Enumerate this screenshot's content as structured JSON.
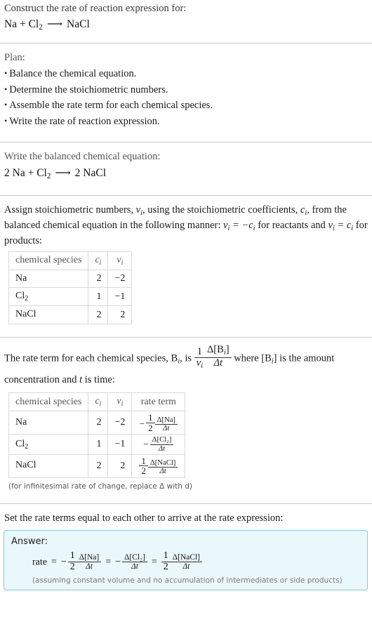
{
  "problem": {
    "prompt": "Construct the rate of reaction expression for:",
    "equation": {
      "reactant1": "Na",
      "plus": "+",
      "reactant2": "Cl",
      "reactant2_sub": "2",
      "arrow": "⟶",
      "product": "NaCl"
    }
  },
  "plan": {
    "label": "Plan:",
    "steps": [
      "Balance the chemical equation.",
      "Determine the stoichiometric numbers.",
      "Assemble the rate term for each chemical species.",
      "Write the rate of reaction expression."
    ]
  },
  "balanced": {
    "label": "Write the balanced chemical equation:",
    "equation": {
      "coef1": "2",
      "reactant1": "Na",
      "plus": "+",
      "reactant2": "Cl",
      "reactant2_sub": "2",
      "arrow": "⟶",
      "coef_product": "2",
      "product": "NaCl"
    }
  },
  "stoich": {
    "text_part1": "Assign stoichiometric numbers, ",
    "sym_nu": "ν",
    "sym_i": "i",
    "text_part2": ", using the stoichiometric coefficients, ",
    "sym_c": "c",
    "text_part3": ", from the balanced chemical equation in the following manner: ",
    "rule_reactants": "ν",
    "text_part4": " = −c",
    "text_part5": " for reactants and ",
    "text_part6": " = c",
    "text_part7": " for products:",
    "table": {
      "headers": [
        "chemical species",
        "c",
        "ν"
      ],
      "header_sub": "i",
      "rows": [
        {
          "species": "Na",
          "species_sub": "",
          "c": "2",
          "nu": "−2"
        },
        {
          "species": "Cl",
          "species_sub": "2",
          "c": "1",
          "nu": "−1"
        },
        {
          "species": "NaCl",
          "species_sub": "",
          "c": "2",
          "nu": "2"
        }
      ]
    }
  },
  "rateterm": {
    "text_part1": "The rate term for each chemical species, B",
    "sub_i": "i",
    "text_part2": ", is ",
    "frac_outer_num": "1",
    "frac_outer_den": "ν",
    "frac_inner_num": "Δ[B",
    "frac_inner_num_end": "]",
    "frac_inner_den": "Δt",
    "text_part3": " where [B",
    "text_part4": "] is the amount concentration and ",
    "sym_t": "t",
    "text_part5": " is time:",
    "table": {
      "headers": [
        "chemical species",
        "c",
        "ν",
        "rate term"
      ],
      "header_sub": "i",
      "rows": [
        {
          "species": "Na",
          "species_sub": "",
          "c": "2",
          "nu": "−2",
          "rate_sign": "−",
          "rate_coef_num": "1",
          "rate_coef_den": "2",
          "rate_num": "Δ[Na]",
          "rate_den": "Δt"
        },
        {
          "species": "Cl",
          "species_sub": "2",
          "c": "1",
          "nu": "−1",
          "rate_sign": "−",
          "rate_coef_num": "",
          "rate_coef_den": "",
          "rate_num": "Δ[Cl₂]",
          "rate_den": "Δt"
        },
        {
          "species": "NaCl",
          "species_sub": "",
          "c": "2",
          "nu": "2",
          "rate_sign": "",
          "rate_coef_num": "1",
          "rate_coef_den": "2",
          "rate_num": "Δ[NaCl]",
          "rate_den": "Δt"
        }
      ]
    },
    "footnote": "(for infinitesimal rate of change, replace Δ with d)"
  },
  "final": {
    "label": "Set the rate terms equal to each other to arrive at the rate expression:",
    "answer_title": "Answer:",
    "rate_label": "rate",
    "equals": "=",
    "term1": {
      "sign": "−",
      "coef_num": "1",
      "coef_den": "2",
      "num": "Δ[Na]",
      "den": "Δt"
    },
    "term2": {
      "sign": "−",
      "coef_num": "",
      "coef_den": "",
      "num": "Δ[Cl₂]",
      "den": "Δt"
    },
    "term3": {
      "sign": "",
      "coef_num": "1",
      "coef_den": "2",
      "num": "Δ[NaCl]",
      "den": "Δt"
    },
    "assumption": "(assuming constant volume and no accumulation of intermediates or side products)"
  },
  "colors": {
    "answer_bg": "#eaf7fb",
    "answer_border": "#8ec7dd",
    "rule": "#c8c8c8",
    "table_border": "#d9d9d9",
    "gray_text": "#555555"
  }
}
